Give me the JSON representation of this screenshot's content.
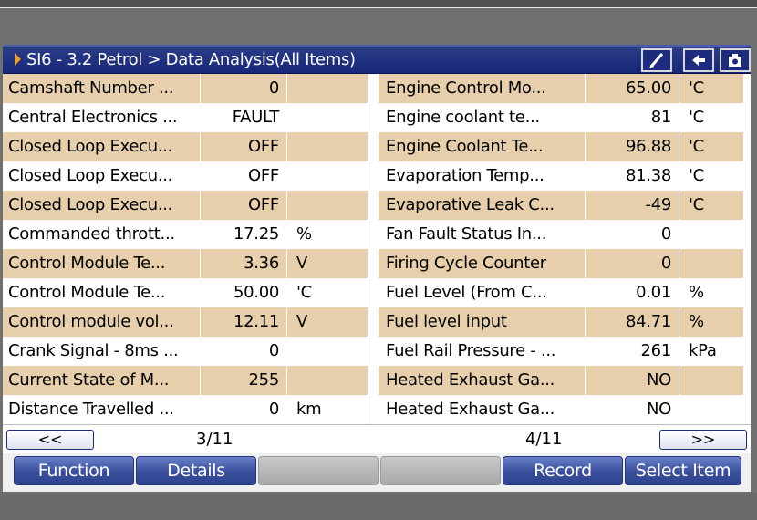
{
  "title": "SI6 - 3.2 Petrol > Data Analysis(All Items)",
  "toolbar": {
    "icons": [
      "brush-icon",
      "back-arrow-icon",
      "camera-icon"
    ]
  },
  "left_table": [
    {
      "name": "Camshaft Number ...",
      "value": "0",
      "unit": ""
    },
    {
      "name": "Central Electronics ...",
      "value": "FAULT",
      "unit": ""
    },
    {
      "name": "Closed Loop Execu...",
      "value": "OFF",
      "unit": ""
    },
    {
      "name": "Closed Loop Execu...",
      "value": "OFF",
      "unit": ""
    },
    {
      "name": "Closed Loop Execu...",
      "value": "OFF",
      "unit": ""
    },
    {
      "name": "Commanded thrott...",
      "value": "17.25",
      "unit": "%"
    },
    {
      "name": "Control Module Te...",
      "value": "3.36",
      "unit": "V"
    },
    {
      "name": "Control Module Te...",
      "value": "50.00",
      "unit": "'C"
    },
    {
      "name": "Control module vol...",
      "value": "12.11",
      "unit": "V"
    },
    {
      "name": "Crank Signal - 8ms ...",
      "value": "0",
      "unit": ""
    },
    {
      "name": "Current State of M...",
      "value": "255",
      "unit": ""
    },
    {
      "name": "Distance Travelled ...",
      "value": "0",
      "unit": "km"
    }
  ],
  "right_table": [
    {
      "name": "Engine Control Mo...",
      "value": "65.00",
      "unit": "'C"
    },
    {
      "name": "Engine coolant te...",
      "value": "81",
      "unit": "'C"
    },
    {
      "name": "Engine Coolant Te...",
      "value": "96.88",
      "unit": "'C"
    },
    {
      "name": "Evaporation Temp...",
      "value": "81.38",
      "unit": "'C"
    },
    {
      "name": "Evaporative Leak C...",
      "value": "-49",
      "unit": "'C"
    },
    {
      "name": "Fan Fault Status In...",
      "value": "0",
      "unit": ""
    },
    {
      "name": "Firing Cycle Counter",
      "value": "0",
      "unit": ""
    },
    {
      "name": "Fuel Level (From C...",
      "value": "0.01",
      "unit": "%"
    },
    {
      "name": "Fuel level input",
      "value": "84.71",
      "unit": "%"
    },
    {
      "name": "Fuel Rail Pressure - ...",
      "value": "261",
      "unit": "kPa"
    },
    {
      "name": "Heated Exhaust Ga...",
      "value": "NO",
      "unit": ""
    },
    {
      "name": "Heated Exhaust Ga...",
      "value": "NO",
      "unit": ""
    }
  ],
  "nav": {
    "prev_label": "<<",
    "next_label": ">>",
    "left_page": "3/11",
    "right_page": "4/11"
  },
  "function_bar": {
    "function_label": "Function",
    "details_label": "Details",
    "blank1_label": "",
    "blank2_label": "",
    "record_label": "Record",
    "select_item_label": "Select Item"
  },
  "colors": {
    "title_bar": "#1c2b7e",
    "row_shade": "#e6cfaa",
    "button": "#3a4f9c"
  }
}
